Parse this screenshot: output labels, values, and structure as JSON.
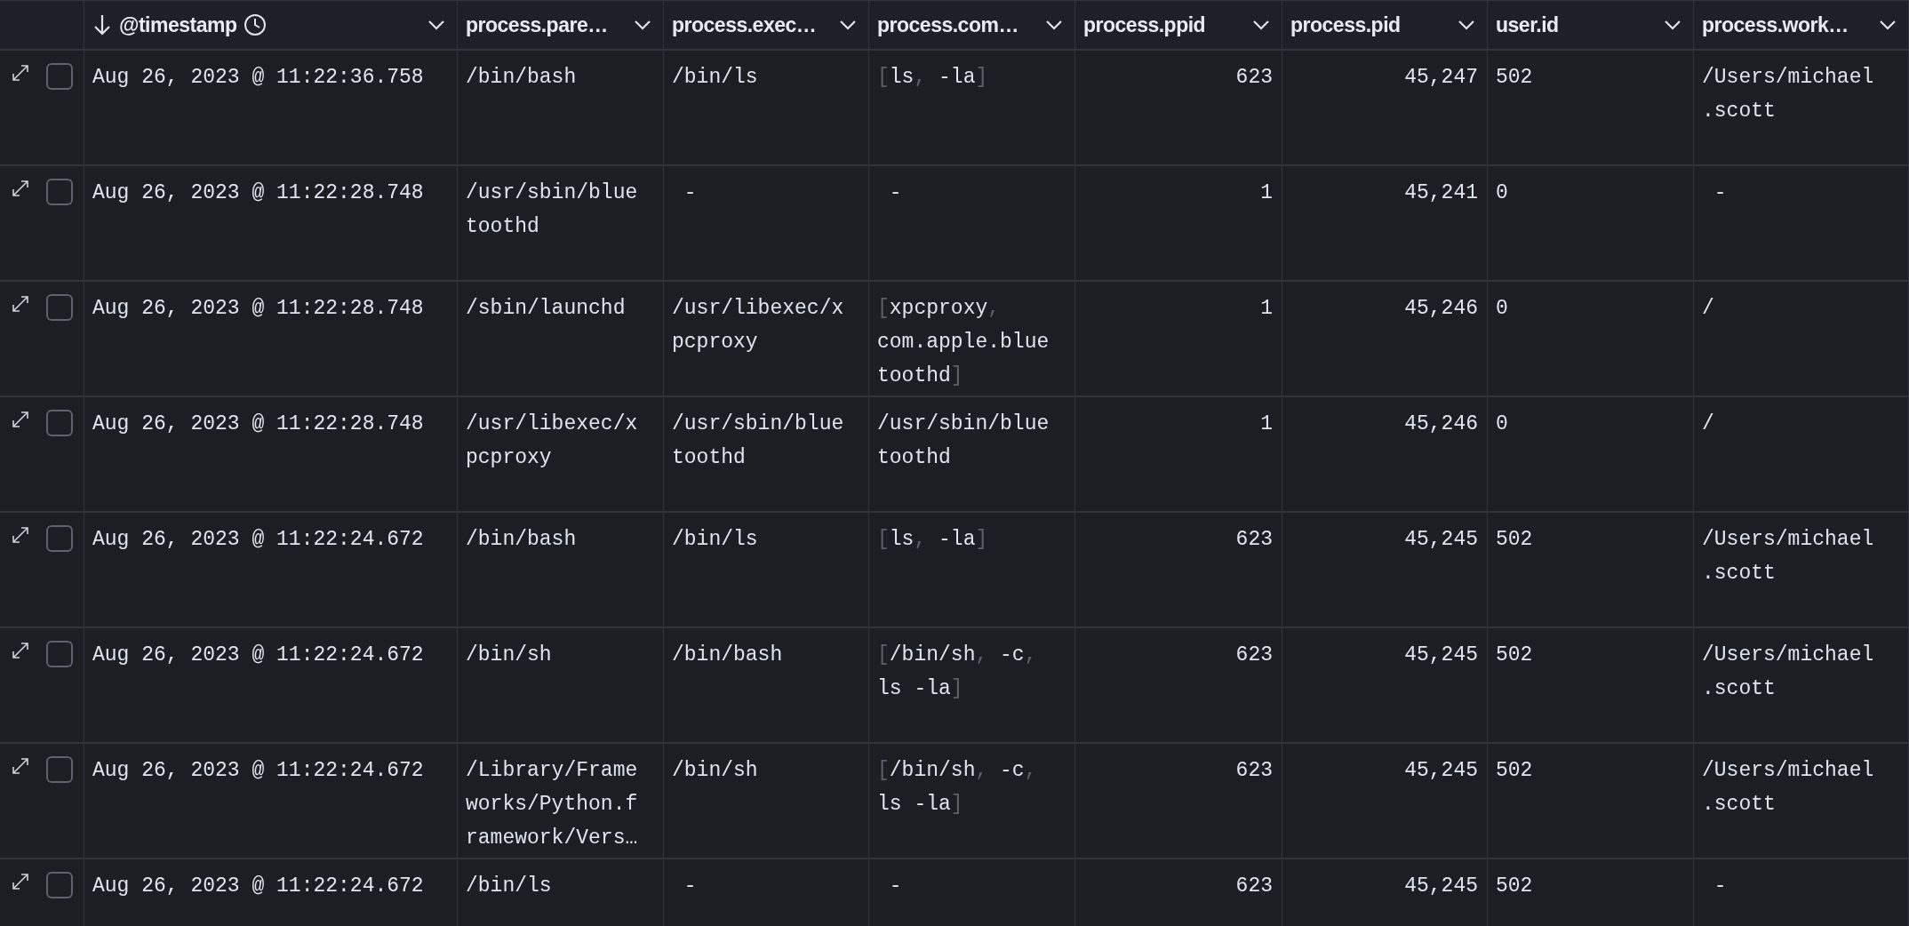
{
  "table": {
    "columns": [
      {
        "label": "@timestamp",
        "kind": "date",
        "sorted": true
      },
      {
        "label": "process.pare…",
        "kind": "field"
      },
      {
        "label": "process.exec…",
        "kind": "field"
      },
      {
        "label": "process.com…",
        "kind": "field"
      },
      {
        "label": "process.ppid",
        "kind": "field"
      },
      {
        "label": "process.pid",
        "kind": "field"
      },
      {
        "label": "user.id",
        "kind": "field"
      },
      {
        "label": "process.work…",
        "kind": "field"
      }
    ],
    "rows": [
      {
        "checked": false,
        "cells": [
          {
            "kind": "text",
            "text": "Aug 26, 2023 @ 11:22:36.758"
          },
          {
            "kind": "text",
            "text": "/bin/bash"
          },
          {
            "kind": "text",
            "text": "/bin/ls"
          },
          {
            "kind": "array",
            "parts": [
              {
                "text": "[",
                "dim": true
              },
              {
                "text": "ls"
              },
              {
                "text": ", ",
                "dim": true
              },
              {
                "text": "-la"
              },
              {
                "text": "]",
                "dim": true
              }
            ]
          },
          {
            "kind": "number",
            "text": "623"
          },
          {
            "kind": "number",
            "text": "45,247"
          },
          {
            "kind": "text",
            "text": "502"
          },
          {
            "kind": "text",
            "text": "/Users/michael.scott"
          }
        ]
      },
      {
        "checked": false,
        "cells": [
          {
            "kind": "text",
            "text": "Aug 26, 2023 @ 11:22:28.748"
          },
          {
            "kind": "text",
            "text": "/usr/sbin/bluetoothd"
          },
          {
            "kind": "empty",
            "text": "-"
          },
          {
            "kind": "empty",
            "text": "-"
          },
          {
            "kind": "number",
            "text": "1"
          },
          {
            "kind": "number",
            "text": "45,241"
          },
          {
            "kind": "text",
            "text": "0"
          },
          {
            "kind": "empty",
            "text": "-"
          }
        ]
      },
      {
        "checked": false,
        "cells": [
          {
            "kind": "text",
            "text": "Aug 26, 2023 @ 11:22:28.748"
          },
          {
            "kind": "text",
            "text": "/sbin/launchd"
          },
          {
            "kind": "text",
            "text": "/usr/libexec/xpcproxy"
          },
          {
            "kind": "array",
            "parts": [
              {
                "text": "[",
                "dim": true
              },
              {
                "text": "xpcproxy"
              },
              {
                "text": ", ",
                "dim": true
              },
              {
                "text": "com.apple.bluetoothd"
              },
              {
                "text": "]",
                "dim": true
              }
            ]
          },
          {
            "kind": "number",
            "text": "1"
          },
          {
            "kind": "number",
            "text": "45,246"
          },
          {
            "kind": "text",
            "text": "0"
          },
          {
            "kind": "text",
            "text": "/"
          }
        ]
      },
      {
        "checked": false,
        "cells": [
          {
            "kind": "text",
            "text": "Aug 26, 2023 @ 11:22:28.748"
          },
          {
            "kind": "text",
            "text": "/usr/libexec/xpcproxy"
          },
          {
            "kind": "text",
            "text": "/usr/sbin/bluetoothd"
          },
          {
            "kind": "text",
            "text": "/usr/sbin/bluetoothd"
          },
          {
            "kind": "number",
            "text": "1"
          },
          {
            "kind": "number",
            "text": "45,246"
          },
          {
            "kind": "text",
            "text": "0"
          },
          {
            "kind": "text",
            "text": "/"
          }
        ]
      },
      {
        "checked": false,
        "cells": [
          {
            "kind": "text",
            "text": "Aug 26, 2023 @ 11:22:24.672"
          },
          {
            "kind": "text",
            "text": "/bin/bash"
          },
          {
            "kind": "text",
            "text": "/bin/ls"
          },
          {
            "kind": "array",
            "parts": [
              {
                "text": "[",
                "dim": true
              },
              {
                "text": "ls"
              },
              {
                "text": ", ",
                "dim": true
              },
              {
                "text": "-la"
              },
              {
                "text": "]",
                "dim": true
              }
            ]
          },
          {
            "kind": "number",
            "text": "623"
          },
          {
            "kind": "number",
            "text": "45,245"
          },
          {
            "kind": "text",
            "text": "502"
          },
          {
            "kind": "text",
            "text": "/Users/michael.scott"
          }
        ]
      },
      {
        "checked": false,
        "cells": [
          {
            "kind": "text",
            "text": "Aug 26, 2023 @ 11:22:24.672"
          },
          {
            "kind": "text",
            "text": "/bin/sh"
          },
          {
            "kind": "text",
            "text": "/bin/bash"
          },
          {
            "kind": "array",
            "parts": [
              {
                "text": "[",
                "dim": true
              },
              {
                "text": "/bin/sh"
              },
              {
                "text": ", ",
                "dim": true
              },
              {
                "text": "-c"
              },
              {
                "text": ", ",
                "dim": true
              },
              {
                "text": "ls -la"
              },
              {
                "text": "]",
                "dim": true
              }
            ]
          },
          {
            "kind": "number",
            "text": "623"
          },
          {
            "kind": "number",
            "text": "45,245"
          },
          {
            "kind": "text",
            "text": "502"
          },
          {
            "kind": "text",
            "text": "/Users/michael.scott"
          }
        ]
      },
      {
        "checked": false,
        "cells": [
          {
            "kind": "text",
            "text": "Aug 26, 2023 @ 11:22:24.672"
          },
          {
            "kind": "text",
            "text": "/Library/Frameworks/Python.framework/Vers…"
          },
          {
            "kind": "text",
            "text": "/bin/sh"
          },
          {
            "kind": "array",
            "parts": [
              {
                "text": "[",
                "dim": true
              },
              {
                "text": "/bin/sh"
              },
              {
                "text": ", ",
                "dim": true
              },
              {
                "text": "-c"
              },
              {
                "text": ", ",
                "dim": true
              },
              {
                "text": "ls -la"
              },
              {
                "text": "]",
                "dim": true
              }
            ]
          },
          {
            "kind": "number",
            "text": "623"
          },
          {
            "kind": "number",
            "text": "45,245"
          },
          {
            "kind": "text",
            "text": "502"
          },
          {
            "kind": "text",
            "text": "/Users/michael.scott"
          }
        ]
      },
      {
        "checked": false,
        "cells": [
          {
            "kind": "text",
            "text": "Aug 26, 2023 @ 11:22:24.672"
          },
          {
            "kind": "text",
            "text": "/bin/ls"
          },
          {
            "kind": "empty",
            "text": "-"
          },
          {
            "kind": "empty",
            "text": "-"
          },
          {
            "kind": "number",
            "text": "623"
          },
          {
            "kind": "number",
            "text": "45,245"
          },
          {
            "kind": "text",
            "text": "502"
          },
          {
            "kind": "empty",
            "text": "-"
          }
        ]
      }
    ]
  }
}
